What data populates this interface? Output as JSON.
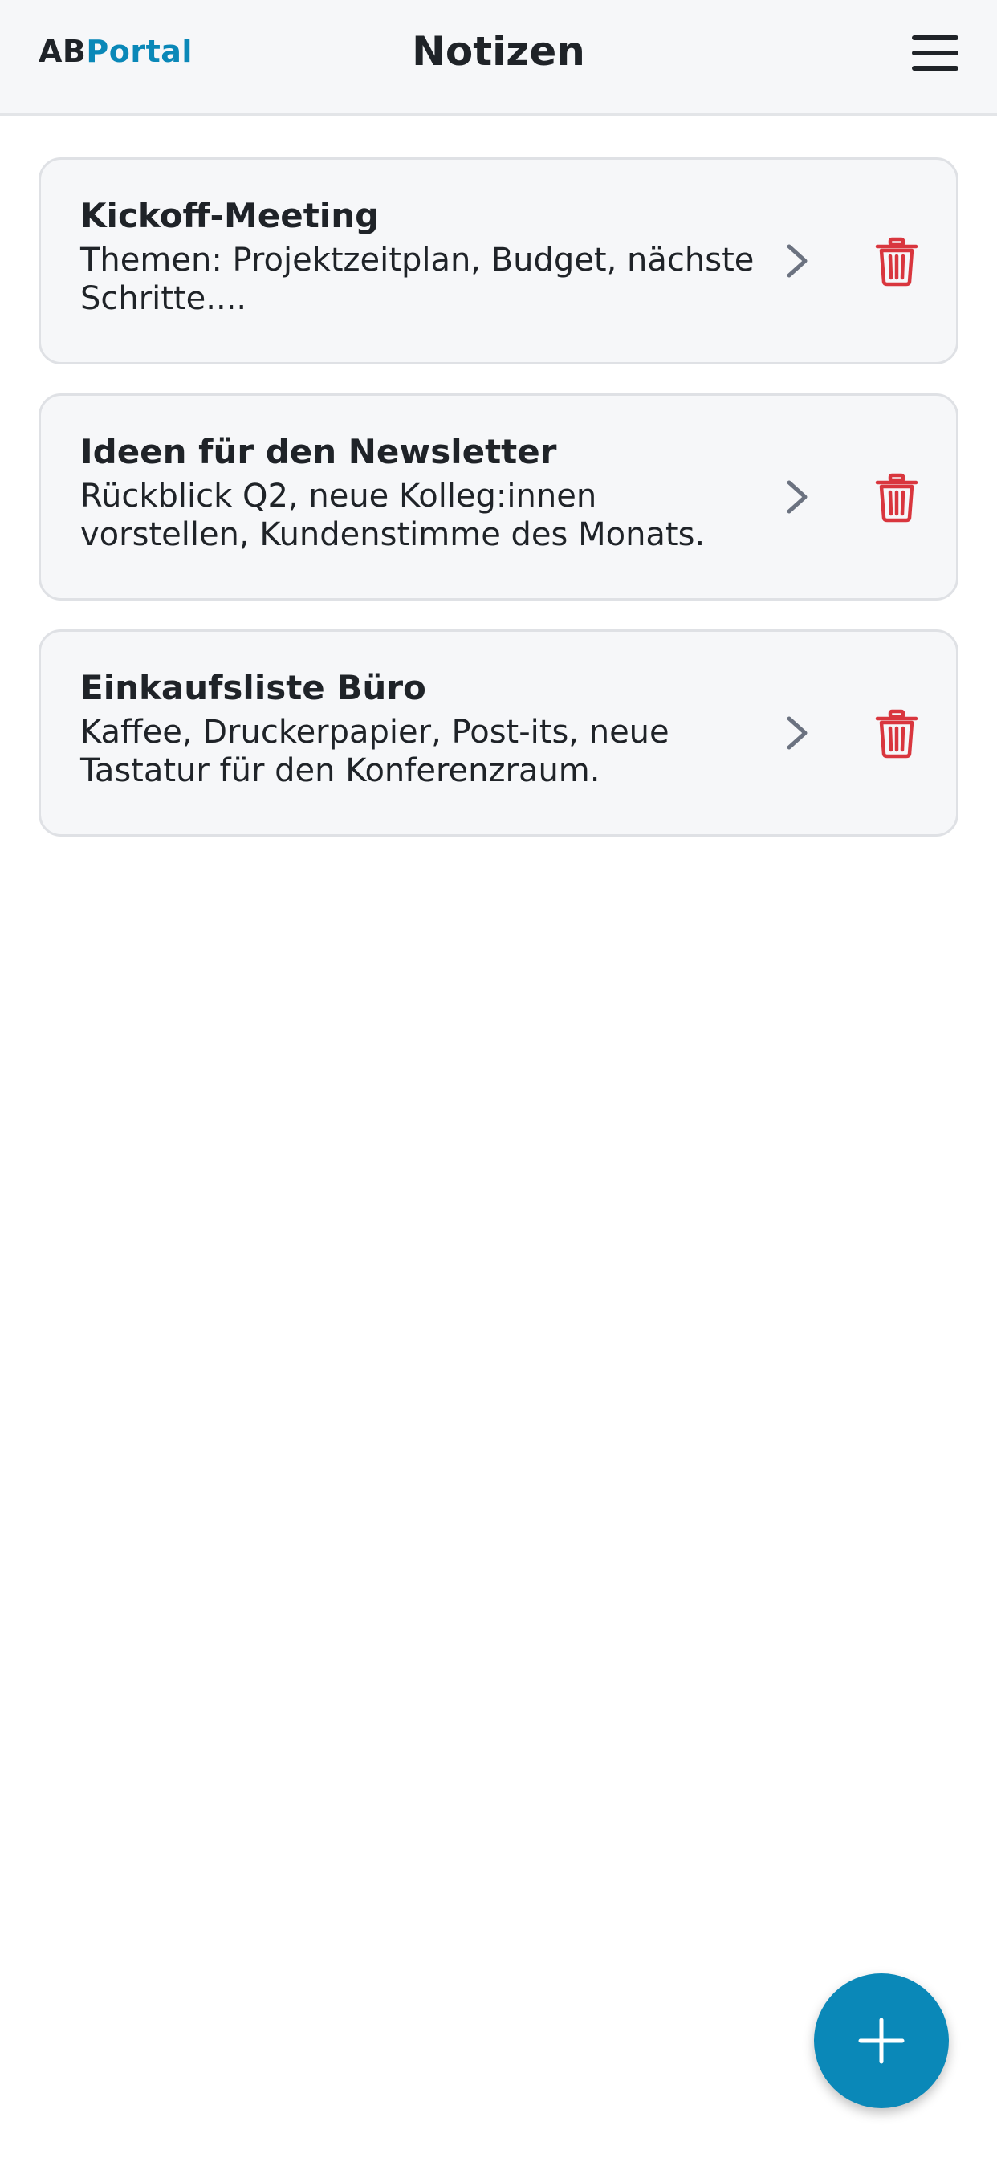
{
  "header": {
    "logo_prefix": "AB",
    "logo_suffix": "Portal",
    "title": "Notizen",
    "menu_icon": "hamburger-menu-icon"
  },
  "notes": [
    {
      "title": "Kickoff-Meeting",
      "preview": "Themen: Projektzeitplan, Budget, nächste Schritte...."
    },
    {
      "title": "Ideen für den Newsletter",
      "preview": "Rückblick Q2, neue Kolleg:innen vorstellen, Kundenstimme des Monats."
    },
    {
      "title": "Einkaufsliste Büro",
      "preview": "Kaffee, Druckerpapier, Post-its, neue Tastatur für den Konferenzraum."
    }
  ],
  "icons": {
    "open_note": "chevron-right-icon",
    "delete_note": "trash-icon",
    "add_note": "plus-icon"
  },
  "colors": {
    "brand": "#0a88b8",
    "delete": "#d9363e",
    "card_background": "#f6f7f9",
    "chevron": "#6b7280"
  }
}
